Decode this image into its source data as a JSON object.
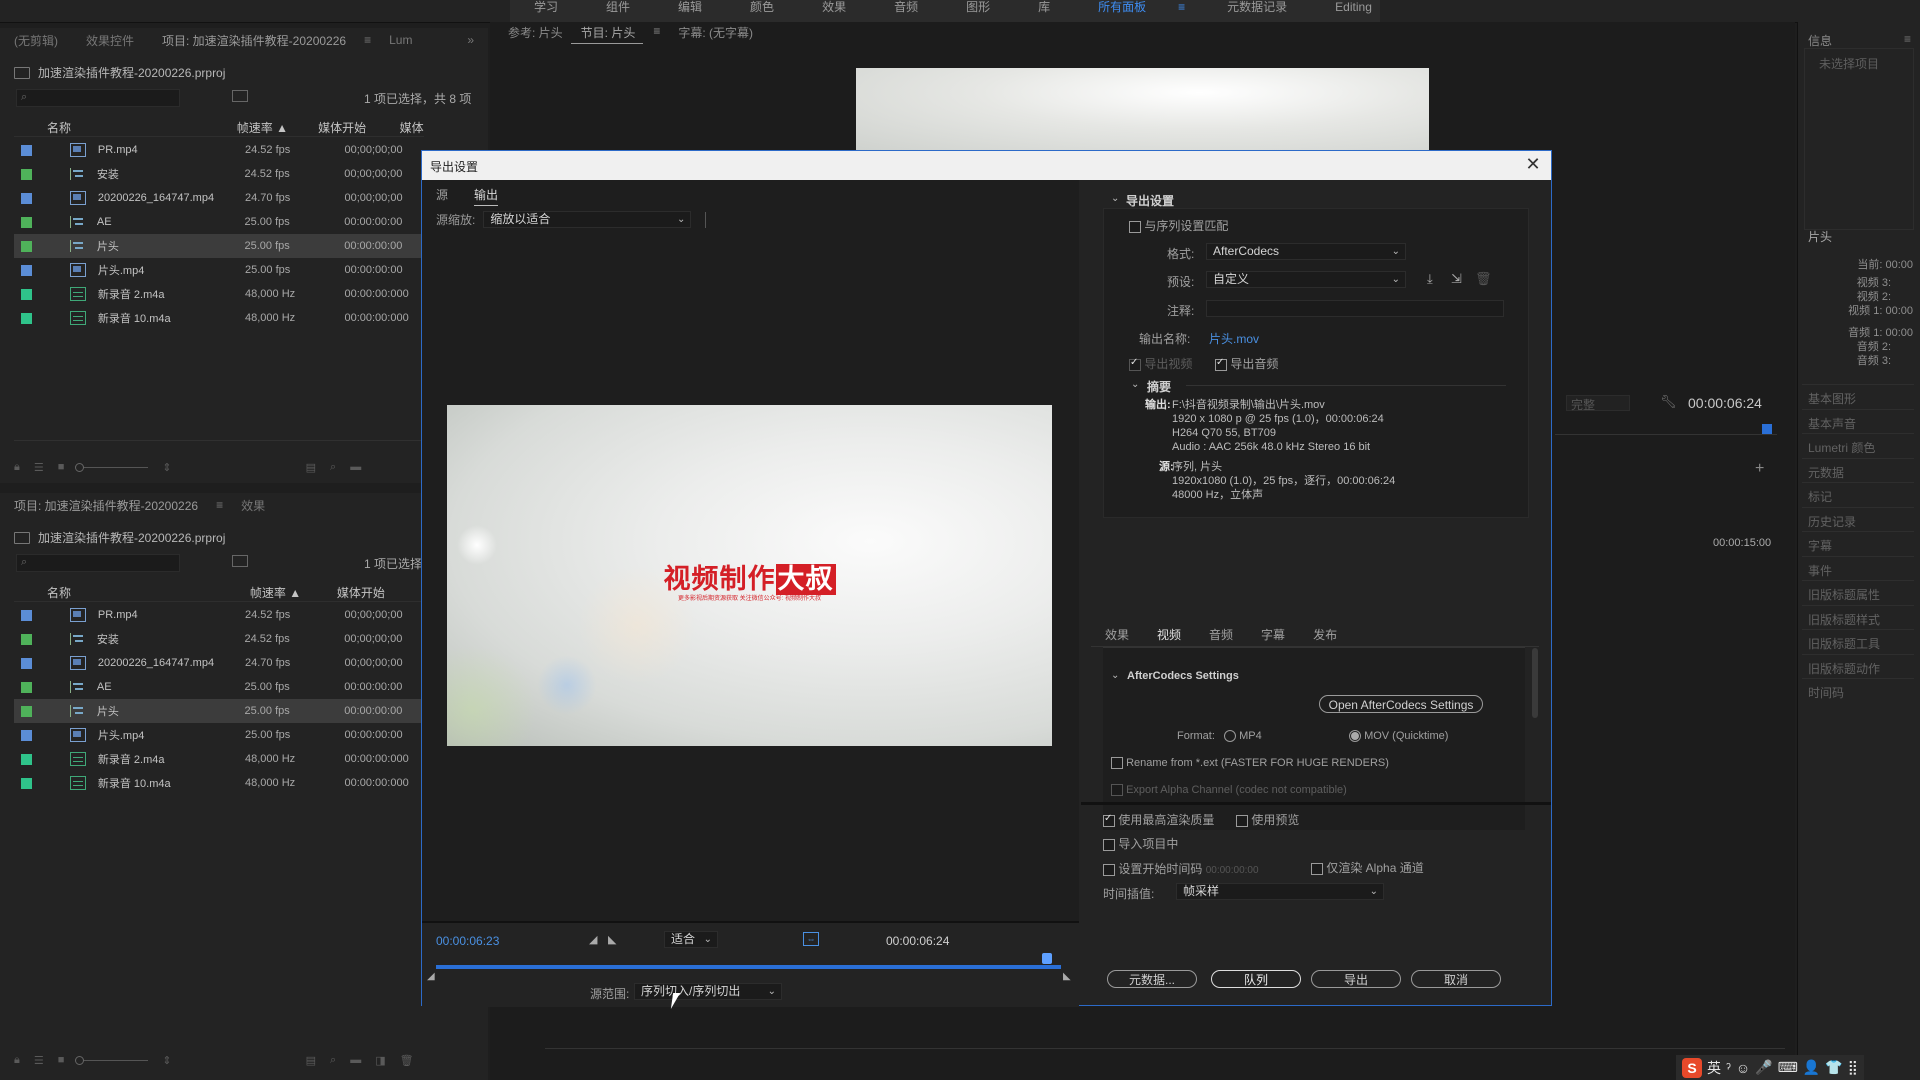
{
  "workspace": {
    "tabs": [
      "学习",
      "组件",
      "编辑",
      "颜色",
      "效果",
      "音频",
      "图形",
      "库",
      "所有面板",
      "元数据记录",
      "Editing"
    ],
    "active": "所有面板",
    "menu_glyph": "≡"
  },
  "project_top": {
    "tabs": [
      "(无剪辑)",
      "效果控件",
      "项目: 加速渲染插件教程-20200226",
      "Lum"
    ],
    "tab_menu": "≡",
    "more": "»",
    "file": "加速渲染插件教程-20200226.prproj",
    "selection": "1 项已选择，共 8 项",
    "columns": [
      "名称",
      "帧速率",
      "媒体开始",
      "媒体结"
    ],
    "sort_glyph": "▲"
  },
  "project_bottom": {
    "tabs": [
      "项目: 加速渲染插件教程-20200226",
      "效果"
    ],
    "tab_menu": "≡",
    "file": "加速渲染插件教程-20200226.prproj",
    "selection": "1 项已选择",
    "columns": [
      "名称",
      "帧速率",
      "媒体开始"
    ],
    "sort_glyph": "▲"
  },
  "items": [
    {
      "name": "PR.mp4",
      "rate": "24.52 fps",
      "tc": "00;00;00;00",
      "color": "#5b8dd6",
      "type": "video"
    },
    {
      "name": "安装",
      "rate": "24.52 fps",
      "tc": "00;00;00;00",
      "color": "#4fb25a",
      "type": "seq"
    },
    {
      "name": "20200226_164747.mp4",
      "rate": "24.70 fps",
      "tc": "00;00;00;00",
      "color": "#5b8dd6",
      "type": "video"
    },
    {
      "name": "AE",
      "rate": "25.00 fps",
      "tc": "00:00:00:00",
      "color": "#4fb25a",
      "type": "seq"
    },
    {
      "name": "片头",
      "rate": "25.00 fps",
      "tc": "00:00:00:00",
      "color": "#4fb25a",
      "type": "seq",
      "selected": true
    },
    {
      "name": "片头.mp4",
      "rate": "25.00 fps",
      "tc": "00:00:00:00",
      "color": "#5b8dd6",
      "type": "video"
    },
    {
      "name": "新录音 2.m4a",
      "rate": "48,000 Hz",
      "tc": "00:00:00:000",
      "color": "#2fc38a",
      "type": "audio"
    },
    {
      "name": "新录音 10.m4a",
      "rate": "48,000 Hz",
      "tc": "00:00:00:000",
      "color": "#2fc38a",
      "type": "audio"
    }
  ],
  "monitor": {
    "tabs": [
      "参考: 片头",
      "节目: 片头",
      "字幕: (无字幕)"
    ],
    "tab_menu": "≡",
    "timecode": "00:00:06:24",
    "fit": "完整",
    "ruler_tc": "00:00:15:00"
  },
  "right_panel": {
    "info_title": "信息",
    "info_menu": "≡",
    "info_placeholder": "未选择项目",
    "seq_name": "片头",
    "rows": [
      "当前: 00:00",
      "视频 3:",
      "视频 2:",
      "视频 1: 00:00",
      "音频 1: 00:00",
      "音频 2:",
      "音频 3:"
    ],
    "panels": [
      "基本图形",
      "基本声音",
      "Lumetri 颜色",
      "元数据",
      "标记",
      "历史记录",
      "字幕",
      "事件",
      "旧版标题属性",
      "旧版标题样式",
      "旧版标题工具",
      "旧版标题动作",
      "时间码"
    ]
  },
  "dialog": {
    "title": "导出设置",
    "close_glyph": "✕",
    "source_tabs": [
      "源",
      "输出"
    ],
    "source_scaling_label": "源缩放:",
    "source_scaling_value": "缩放以适合",
    "preview_brand_prefix": "视频制作",
    "preview_brand_highlight": "大叔",
    "preview_brand_sub": "更多影视后期资源获取  关注微信公众号: 视频制作大叔",
    "current_tc": "00:00:06:23",
    "fit_label": "适合",
    "end_tc": "00:00:06:24",
    "source_range_label": "源范围:",
    "source_range_value": "序列切入/序列切出",
    "export_settings_header": "导出设置",
    "match_sequence": "与序列设置匹配",
    "format_label": "格式:",
    "format_value": "AfterCodecs",
    "preset_label": "预设:",
    "preset_value": "自定义",
    "comment_label": "注释:",
    "comment_value": "",
    "output_name_label": "输出名称:",
    "output_name_value": "片头.mov",
    "export_video": "导出视频",
    "export_audio": "导出音频",
    "summary_header": "摘要",
    "summary_output_label": "输出:",
    "summary_output": [
      "F:\\抖音视频录制\\输出\\片头.mov",
      "1920 x 1080 p @ 25 fps (1.0)，00:00:06:24",
      "H264 Q70 55, BT709",
      "Audio : AAC 256k 48.0 kHz Stereo 16 bit"
    ],
    "summary_source_label": "源:",
    "summary_source": [
      "序列, 片头",
      "1920x1080 (1.0)，25 fps，逐行，00:00:06:24",
      "48000 Hz，立体声"
    ],
    "tabs": [
      "效果",
      "视频",
      "音频",
      "字幕",
      "发布"
    ],
    "active_tab": "视频",
    "codec_section": "AfterCodecs Settings",
    "open_settings_button": "Open AfterCodecs Settings",
    "format_radio_label": "Format:",
    "format_mp4": "MP4",
    "format_mov": "MOV (Quicktime)",
    "rename_option": "Rename from *.ext (FASTER FOR HUGE RENDERS)",
    "alpha_option": "Export Alpha Channel (codec not compatible)",
    "max_render_quality": "使用最高渲染质量",
    "use_previews": "使用预览",
    "import_into_project": "导入项目中",
    "set_start_tc": "设置开始时间码",
    "start_tc_value": "00:00:00:00",
    "render_alpha_only": "仅渲染 Alpha 通道",
    "time_interp_label": "时间插值:",
    "time_interp_value": "帧采样",
    "btn_metadata": "元数据...",
    "btn_queue": "队列",
    "btn_export": "导出",
    "btn_cancel": "取消"
  },
  "tray": {
    "ime": "英",
    "glyphs": [
      "ˀ",
      "☺",
      "🎤",
      "⌨",
      "👤",
      "👕",
      "⣿"
    ]
  }
}
